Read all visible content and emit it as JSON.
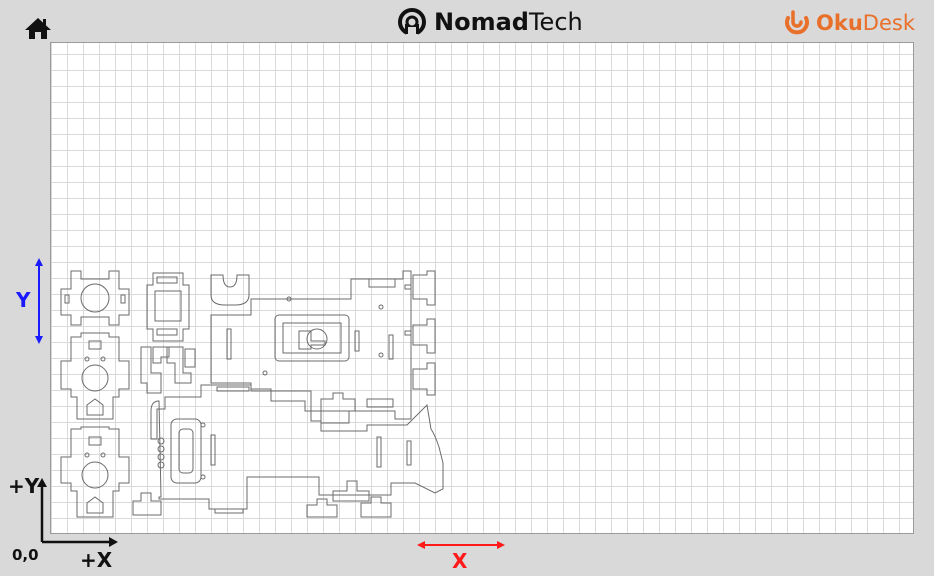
{
  "header": {
    "home_icon": "home-icon",
    "center_brand": {
      "bold": "Nomad",
      "light": "Tech",
      "logo_icon": "nomadtech-logo-icon"
    },
    "right_brand": {
      "bold": "Oku",
      "light": "Desk",
      "logo_icon": "okudesk-logo-icon",
      "color": "#e8702a"
    }
  },
  "workspace": {
    "y_axis_label": "Y",
    "x_axis_label": "X",
    "plus_y_label": "+Y",
    "plus_x_label": "+X",
    "origin_label": "0,0",
    "y_color": "#1a1aff",
    "x_color": "#ff1a1a"
  }
}
